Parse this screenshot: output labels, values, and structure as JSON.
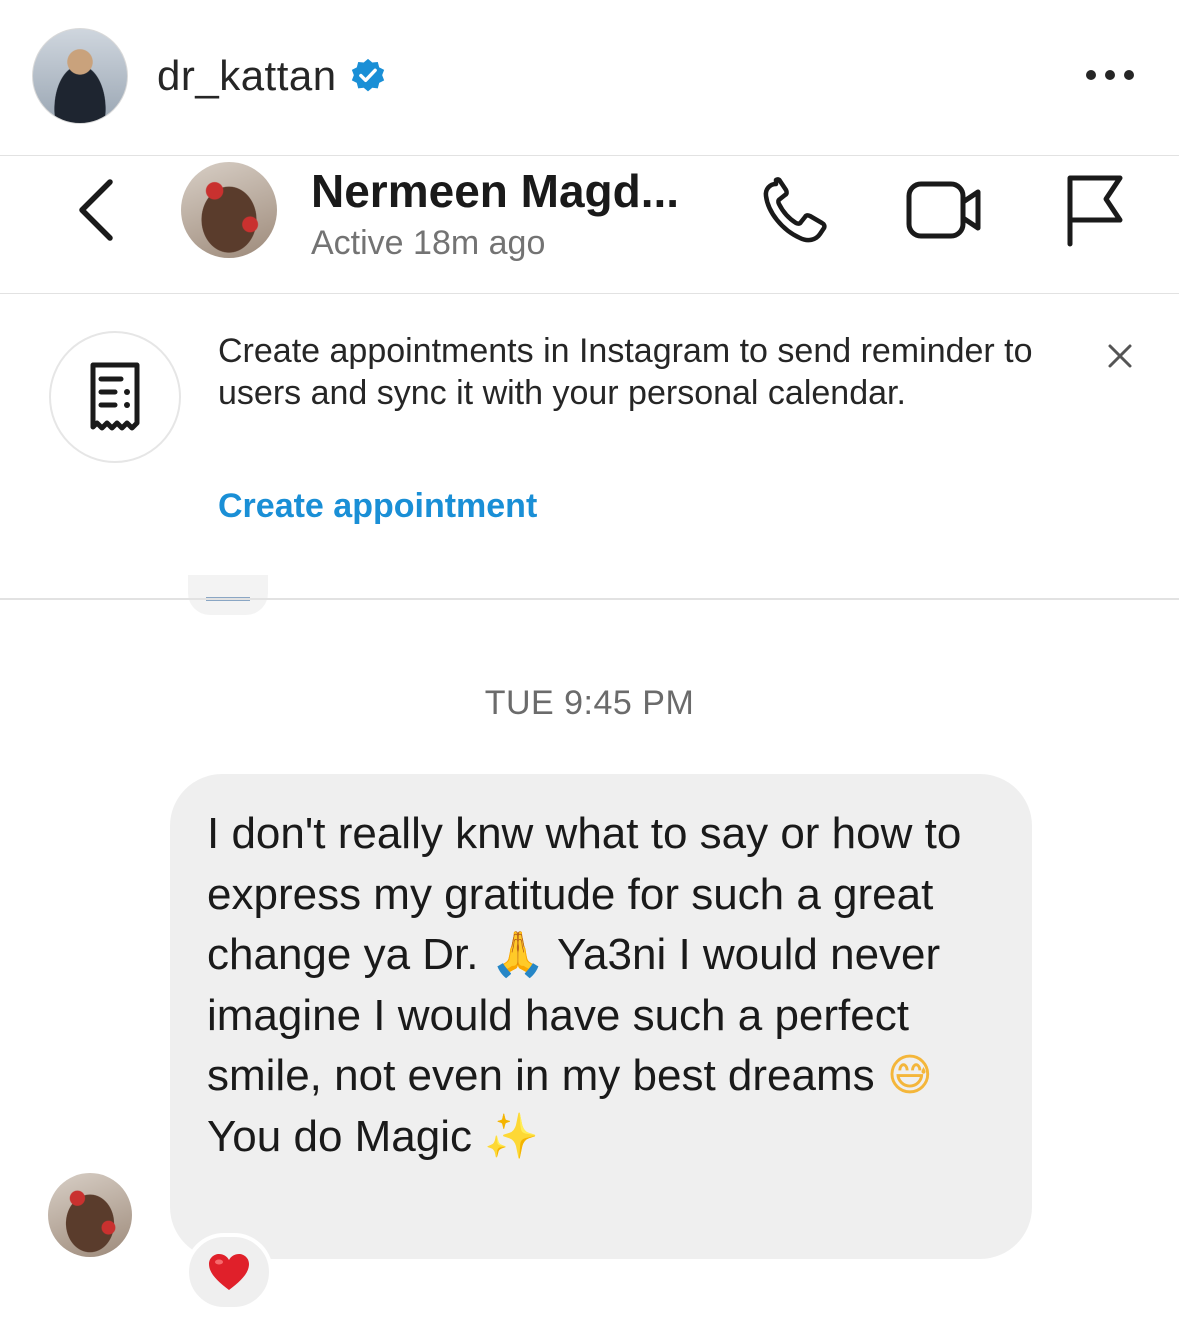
{
  "post_header": {
    "username": "dr_kattan",
    "verified_icon": "verified-badge-icon",
    "more_icon": "more-horizontal-icon"
  },
  "chat_header": {
    "back_icon": "chevron-left-icon",
    "name": "Nermeen Magd...",
    "status": "Active 18m ago",
    "actions": [
      "phone-icon",
      "video-icon",
      "flag-icon"
    ]
  },
  "banner": {
    "icon": "receipt-icon",
    "text": "Create appointments in Instagram to send reminder to users and sync it with your personal calendar.",
    "link": "Create appointment",
    "close_icon": "close-icon"
  },
  "chat": {
    "timestamp": "TUE 9:45 PM",
    "message": {
      "part1": "I don't really knw what to say or how to express my gratitude for such a great change ya Dr. ",
      "emoji1": "🙏",
      "part2": " Ya3ni I would never imagine I would have such a perfect smile, not even in my best dreams ",
      "emoji2": "😅",
      "part3": " You do Magic ",
      "emoji3": "✨"
    },
    "reaction": "❤️"
  },
  "colors": {
    "link": "#1a8fd6",
    "verified": "#1a8fd6",
    "bubble": "#efefef",
    "heart": "#e0202a"
  }
}
